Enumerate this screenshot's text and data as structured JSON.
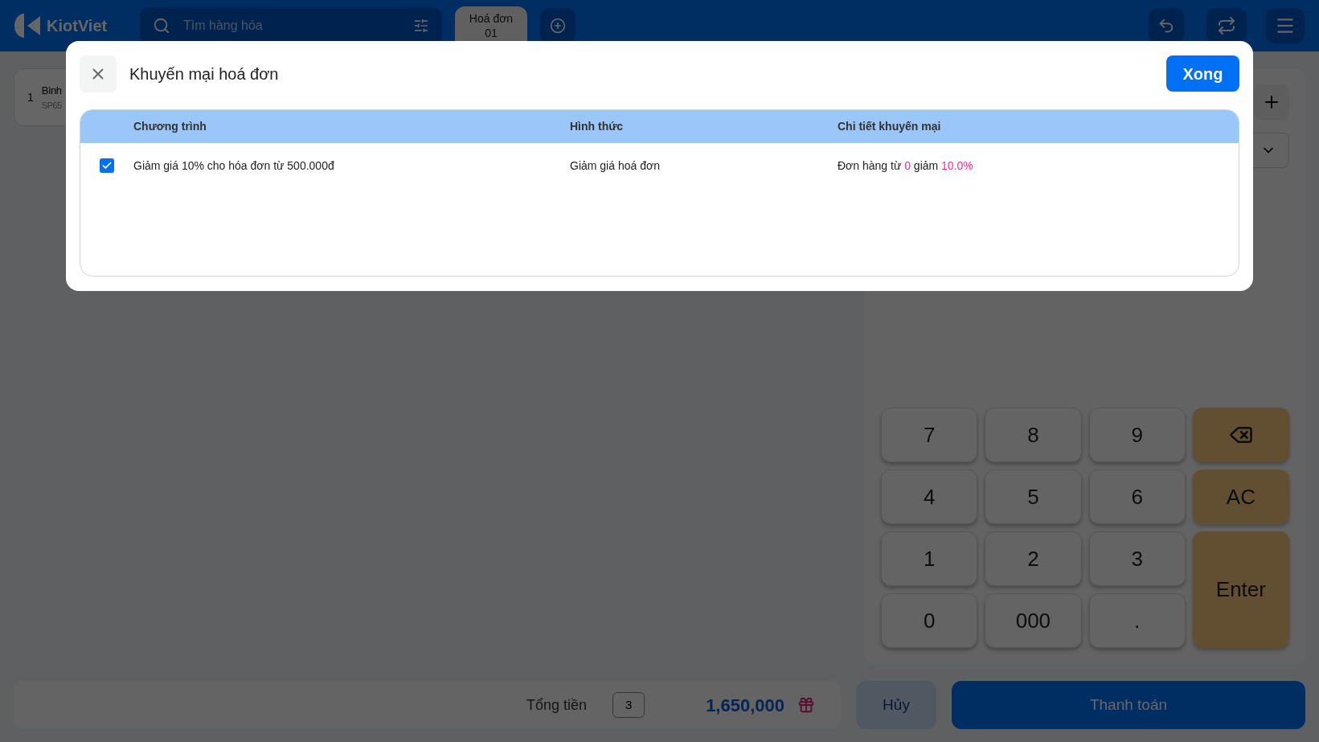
{
  "topbar": {
    "logo": "KiotViet",
    "search": {
      "placeholder": "Tìm hàng hóa"
    },
    "tabs": [
      {
        "label": "Hoá đơn",
        "number": "01",
        "selected": true
      }
    ]
  },
  "cart": [
    {
      "index": "1",
      "name": "Bình",
      "code": "SP65"
    }
  ],
  "keypad": [
    {
      "kind": "digit",
      "label": "7"
    },
    {
      "kind": "digit",
      "label": "8"
    },
    {
      "kind": "digit",
      "label": "9"
    },
    {
      "kind": "backspace"
    },
    {
      "kind": "digit",
      "label": "4"
    },
    {
      "kind": "digit",
      "label": "5"
    },
    {
      "kind": "digit",
      "label": "6"
    },
    {
      "kind": "action",
      "label": "AC"
    },
    {
      "kind": "digit",
      "label": "1"
    },
    {
      "kind": "digit",
      "label": "2"
    },
    {
      "kind": "digit",
      "label": "3"
    },
    {
      "kind": "enter",
      "label": "Enter"
    },
    {
      "kind": "digit",
      "label": "0"
    },
    {
      "kind": "digit",
      "label": "000"
    },
    {
      "kind": "digit",
      "label": "."
    }
  ],
  "footer": {
    "total_label": "Tổng tiền",
    "quantity": "3",
    "total": "1,650,000",
    "cancel": "Hủy",
    "pay": "Thanh toán"
  },
  "modal": {
    "title": "Khuyến mại hoá đơn",
    "done": "Xong",
    "table": {
      "columns": [
        "Chương trình",
        "Hình thức",
        "Chi tiết khuyến mại"
      ],
      "rows": [
        {
          "checked": true,
          "program": "Giảm giá 10% cho hóa đơn từ 500.000đ",
          "type": "Giảm giá hoá đơn",
          "detail": [
            "Đơn hàng từ ",
            "0",
            " giảm ",
            "10.0%"
          ]
        }
      ]
    }
  }
}
